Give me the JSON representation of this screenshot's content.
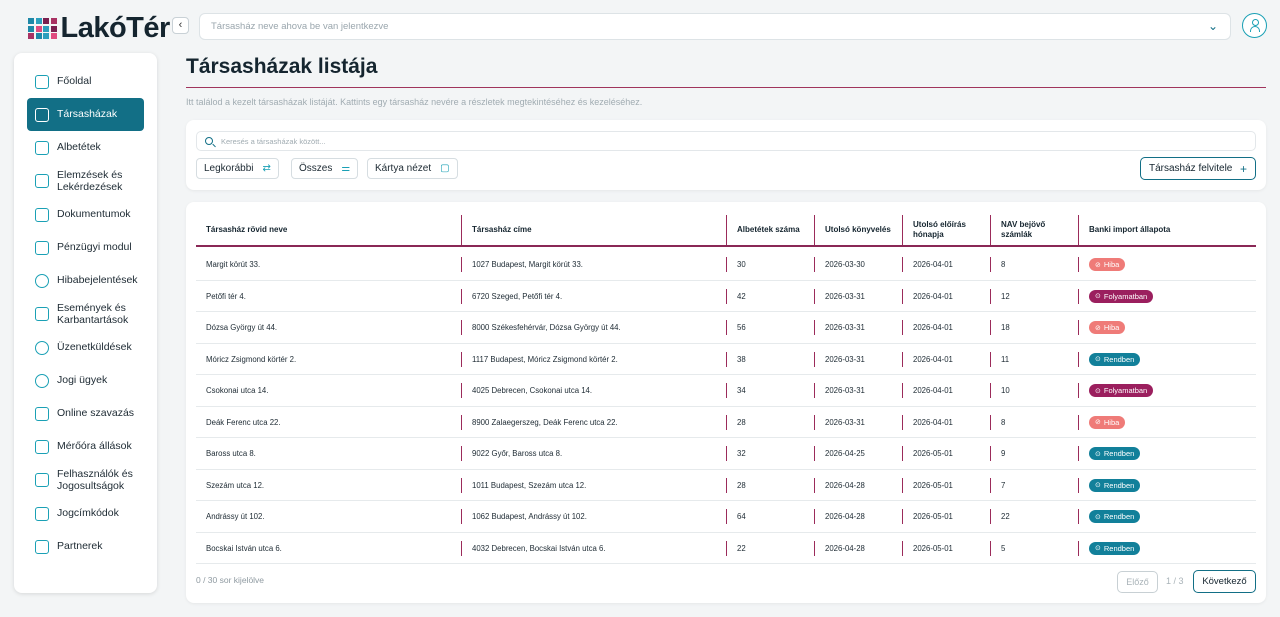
{
  "app": {
    "logo_text": "LakóTér",
    "logo_colors": [
      "#1e88a8",
      "#2c9fbd",
      "#7a1f4f",
      "#a83263",
      "#1e88a8",
      "#e04a7f",
      "#2c9fbd",
      "#7a1f4f",
      "#a83263",
      "#1e88a8",
      "#2c9fbd",
      "#e04a7f"
    ]
  },
  "sidebar": {
    "items": [
      {
        "label": "Főoldal",
        "icon": "home-icon",
        "active": false
      },
      {
        "label": "Társasházak",
        "icon": "buildings-icon",
        "active": true
      },
      {
        "label": "Albetétek",
        "icon": "apartment-icon",
        "active": false
      },
      {
        "label": "Elemzések és Lekérdezések",
        "icon": "layers-icon",
        "active": false
      },
      {
        "label": "Dokumentumok",
        "icon": "document-icon",
        "active": false
      },
      {
        "label": "Pénzügyi modul",
        "icon": "finance-icon",
        "active": false
      },
      {
        "label": "Hibabejelentések",
        "icon": "gears-icon",
        "active": false
      },
      {
        "label": "Események és Karbantartások",
        "icon": "calendar-icon",
        "active": false
      },
      {
        "label": "Üzenetküldések",
        "icon": "chat-icon",
        "active": false
      },
      {
        "label": "Jogi ügyek",
        "icon": "legal-icon",
        "active": false
      },
      {
        "label": "Online szavazás",
        "icon": "vote-icon",
        "active": false
      },
      {
        "label": "Mérőóra állások",
        "icon": "meter-icon",
        "active": false
      },
      {
        "label": "Felhasználók és Jogosultságok",
        "icon": "users-icon",
        "active": false
      },
      {
        "label": "Jogcímkódok",
        "icon": "code-icon",
        "active": false
      },
      {
        "label": "Partnerek",
        "icon": "handshake-icon",
        "active": false
      }
    ]
  },
  "topbar": {
    "collapse_glyph": "‹",
    "selector_placeholder": "Társasház neve ahova be van jelentkezve",
    "chevron_glyph": "⌄"
  },
  "page": {
    "title": "Társasházak listája",
    "subtitle": "Itt találod a kezelt társasházak listáját. Kattints egy társasház nevére a részletek megtekintéséhez és kezeléséhez."
  },
  "filters": {
    "search_placeholder": "Keresés a társasházak között...",
    "sort_label": "Legkorábbi",
    "sort_glyph": "⇄",
    "filter_label": "Összes",
    "filter_glyph": "⚌",
    "view_label": "Kártya nézet",
    "view_glyph": "▢",
    "add_label": "Társasház felvitele",
    "add_glyph": "+"
  },
  "table": {
    "headers": [
      "Társasház rövid neve",
      "Társasház címe",
      "Albetétek száma",
      "Utolsó könyvelés",
      "Utolsó előírás hónapja",
      "NAV bejövő számlák",
      "Banki import állapota"
    ],
    "rows": [
      {
        "name": "Margit körút 33.",
        "address": "1027 Budapest, Margit körút 33.",
        "units": "30",
        "last_booking": "2026-03-30",
        "last_month": "2026-04-01",
        "nav": "8",
        "status": "Hiba",
        "status_type": "error"
      },
      {
        "name": "Petőfi tér 4.",
        "address": "6720 Szeged, Petőfi tér 4.",
        "units": "42",
        "last_booking": "2026-03-31",
        "last_month": "2026-04-01",
        "nav": "12",
        "status": "Folyamatban",
        "status_type": "progress"
      },
      {
        "name": "Dózsa György út 44.",
        "address": "8000 Székesfehérvár, Dózsa György út 44.",
        "units": "56",
        "last_booking": "2026-03-31",
        "last_month": "2026-04-01",
        "nav": "18",
        "status": "Hiba",
        "status_type": "error"
      },
      {
        "name": "Móricz Zsigmond körtér 2.",
        "address": "1117 Budapest, Móricz Zsigmond körtér 2.",
        "units": "38",
        "last_booking": "2026-03-31",
        "last_month": "2026-04-01",
        "nav": "11",
        "status": "Rendben",
        "status_type": "ok"
      },
      {
        "name": "Csokonai utca 14.",
        "address": "4025 Debrecen, Csokonai utca 14.",
        "units": "34",
        "last_booking": "2026-03-31",
        "last_month": "2026-04-01",
        "nav": "10",
        "status": "Folyamatban",
        "status_type": "progress"
      },
      {
        "name": "Deák Ferenc utca 22.",
        "address": "8900 Zalaegerszeg, Deák Ferenc utca 22.",
        "units": "28",
        "last_booking": "2026-03-31",
        "last_month": "2026-04-01",
        "nav": "8",
        "status": "Hiba",
        "status_type": "error"
      },
      {
        "name": "Baross utca 8.",
        "address": "9022 Győr, Baross utca 8.",
        "units": "32",
        "last_booking": "2026-04-25",
        "last_month": "2026-05-01",
        "nav": "9",
        "status": "Rendben",
        "status_type": "ok"
      },
      {
        "name": "Szezám utca 12.",
        "address": "1011 Budapest, Szezám utca 12.",
        "units": "28",
        "last_booking": "2026-04-28",
        "last_month": "2026-05-01",
        "nav": "7",
        "status": "Rendben",
        "status_type": "ok"
      },
      {
        "name": "Andrássy út 102.",
        "address": "1062 Budapest, Andrássy út 102.",
        "units": "64",
        "last_booking": "2026-04-28",
        "last_month": "2026-05-01",
        "nav": "22",
        "status": "Rendben",
        "status_type": "ok"
      },
      {
        "name": "Bocskai István utca 6.",
        "address": "4032 Debrecen, Bocskai István utca 6.",
        "units": "22",
        "last_booking": "2026-04-28",
        "last_month": "2026-05-01",
        "nav": "5",
        "status": "Rendben",
        "status_type": "ok"
      }
    ]
  },
  "status_colors": {
    "error": "#ef7b78",
    "progress": "#9b1f5e",
    "ok": "#12809a"
  },
  "status_glyphs": {
    "error": "⊘",
    "progress": "⊙",
    "ok": "⊙"
  },
  "footer": {
    "selected_text": "0 / 30 sor kijelölve",
    "prev_label": "Előző",
    "page_info": "1 / 3",
    "next_label": "Következő"
  }
}
